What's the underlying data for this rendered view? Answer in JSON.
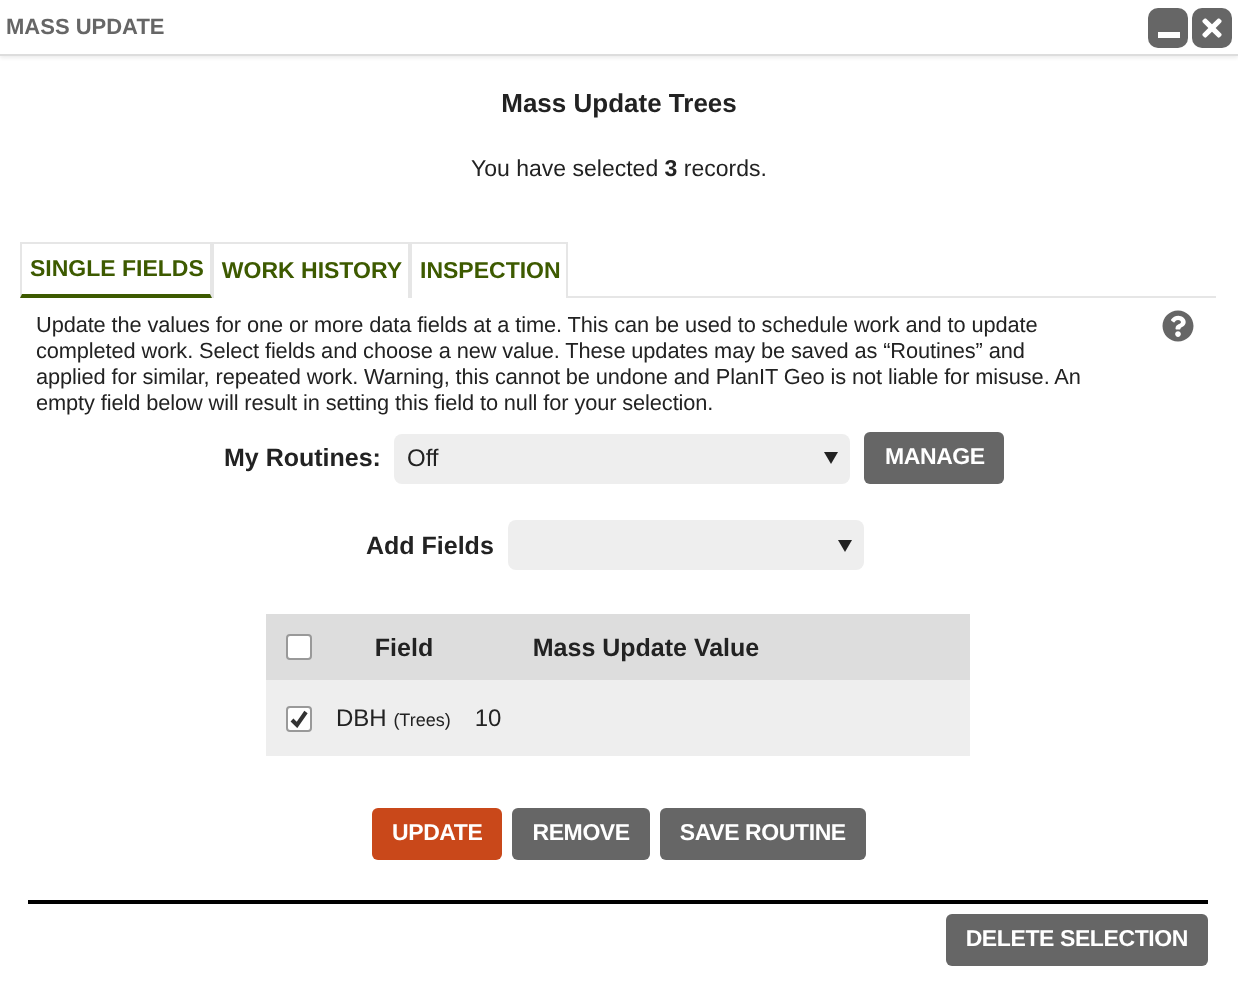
{
  "window": {
    "title": "MASS UPDATE"
  },
  "heading": "Mass Update Trees",
  "selection_note": "You have selected **3** records.",
  "tabs": [
    {
      "label": "SINGLE FIELDS",
      "selected": true
    },
    {
      "label": "WORK HISTORY",
      "selected": false
    },
    {
      "label": "INSPECTION",
      "selected": false
    }
  ],
  "description": "Update the values for one or more data fields at a time. This can be used to schedule work and to update completed work. Select fields and choose a new value. These updates may be saved as “Routines” and applied for similar, repeated work. Warning, this cannot be undone and PlanIT Geo is not liable for misuse. An empty field below will result in setting this field to null for your selection.",
  "routines": {
    "label": "My Routines:",
    "value": "Off",
    "button": "MANAGE"
  },
  "add_fields": {
    "label": "Add Fields"
  },
  "table": {
    "select_all_checked": false,
    "columns": [
      "Field",
      "Mass Update Value"
    ],
    "rows": [
      {
        "checked": true,
        "field": "DBH",
        "note": "(Trees)",
        "value": "10"
      }
    ]
  },
  "actions": [
    {
      "label": "UPDATE",
      "kind": "primary"
    },
    {
      "label": "REMOVE",
      "kind": "secondary"
    },
    {
      "label": "SAVE ROUTINE",
      "kind": "secondary"
    }
  ],
  "footer_button": "DELETE SELECTION"
}
